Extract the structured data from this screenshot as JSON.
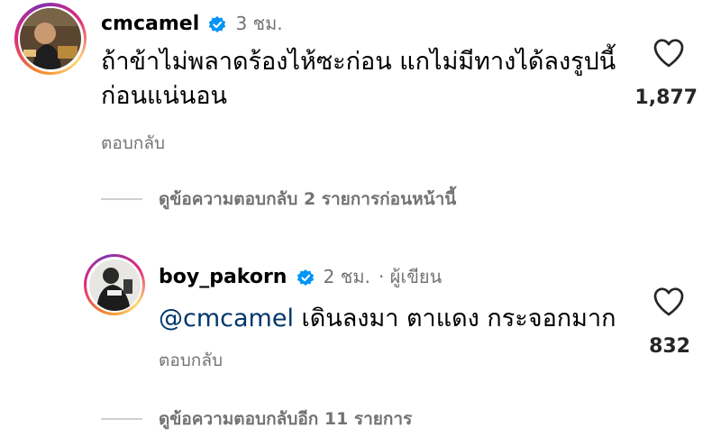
{
  "comments": [
    {
      "username": "cmcamel",
      "time": "3 ชม.",
      "text_line1": "ถ้าข้าไม่พลาดร้องไห้ซะก่อน แกไม่มีทางได้ลงรูปนี้",
      "text_line2": "ก่อนแน่นอน",
      "reply_label": "ตอบกลับ",
      "like_count": "1,877",
      "view_replies": "ดูข้อความตอบกลับ 2 รายการก่อนหน้านี้"
    },
    {
      "username": "boy_pakorn",
      "time": "2 ชม.",
      "author_tag": "· ผู้เขียน",
      "mention": "@cmcamel",
      "text": " เดินลงมา ตาแดง กระจอกมาก",
      "reply_label": "ตอบกลับ",
      "like_count": "832",
      "view_replies": "ดูข้อความตอบกลับอีก 11 รายการ"
    }
  ],
  "icons": {
    "verified": "verified-badge-icon",
    "heart": "heart-outline-icon"
  },
  "colors": {
    "verified_blue": "#0095f6",
    "mention": "#00376b",
    "secondary_text": "#737373"
  }
}
